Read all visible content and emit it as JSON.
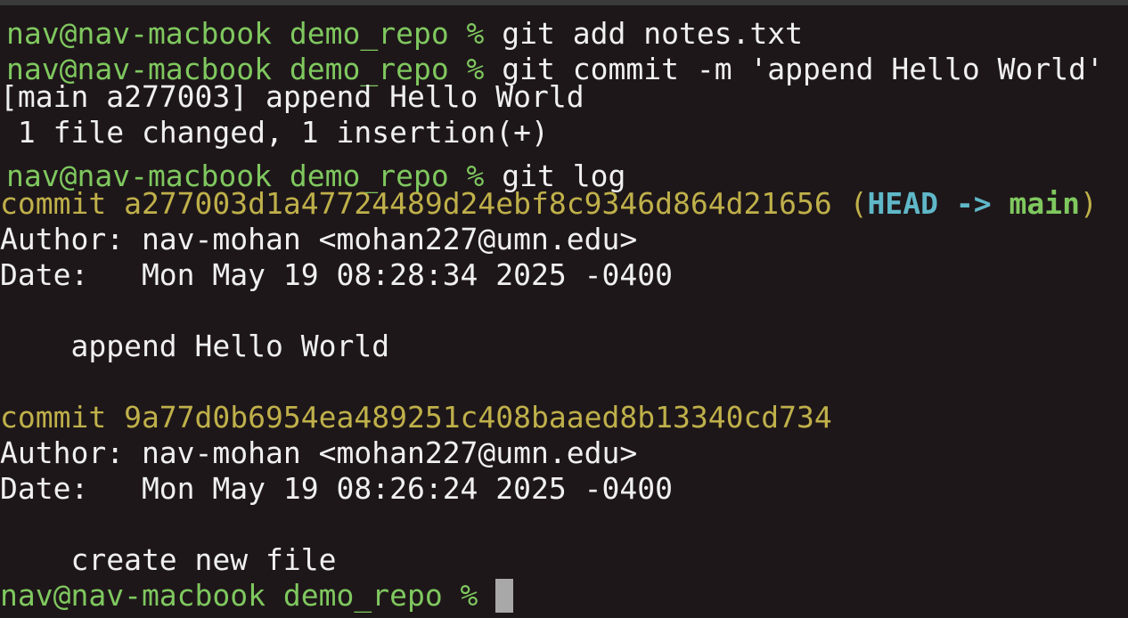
{
  "prompt": "nav@nav-macbook demo_repo % ",
  "line_marker": "[",
  "lines": {
    "l1": {
      "command": "git add notes.txt"
    },
    "l2": {
      "command": "git commit -m 'append Hello World'"
    },
    "l3": {
      "text": "[main a277003] append Hello World"
    },
    "l4": {
      "text": " 1 file changed, 1 insertion(+)"
    },
    "l5": {
      "command": "git log"
    },
    "l6": {
      "commit_label": "commit a277003d1a47724489d24ebf8c9346d864d21656",
      "paren_open": " (",
      "head": "HEAD",
      "arrow": " -> ",
      "branch": "main",
      "paren_close": ")"
    },
    "l7": {
      "text": "Author: nav-mohan <mohan227@umn.edu>"
    },
    "l8": {
      "text": "Date:   Mon May 19 08:28:34 2025 -0400"
    },
    "l10": {
      "text": "    append Hello World"
    },
    "l12": {
      "commit_label": "commit 9a77d0b6954ea489251c408baaed8b13340cd734"
    },
    "l13": {
      "text": "Author: nav-mohan <mohan227@umn.edu>"
    },
    "l14": {
      "text": "Date:   Mon May 19 08:26:24 2025 -0400"
    },
    "l16": {
      "text": "    create new file"
    }
  },
  "colors": {
    "background": "#1e1719",
    "prompt": "#7fc85f",
    "commit_hash": "#bfb04a",
    "head": "#5fb8c8",
    "branch": "#7fc85f",
    "text": "#f0f0f0",
    "cursor": "#a8a8a8"
  }
}
